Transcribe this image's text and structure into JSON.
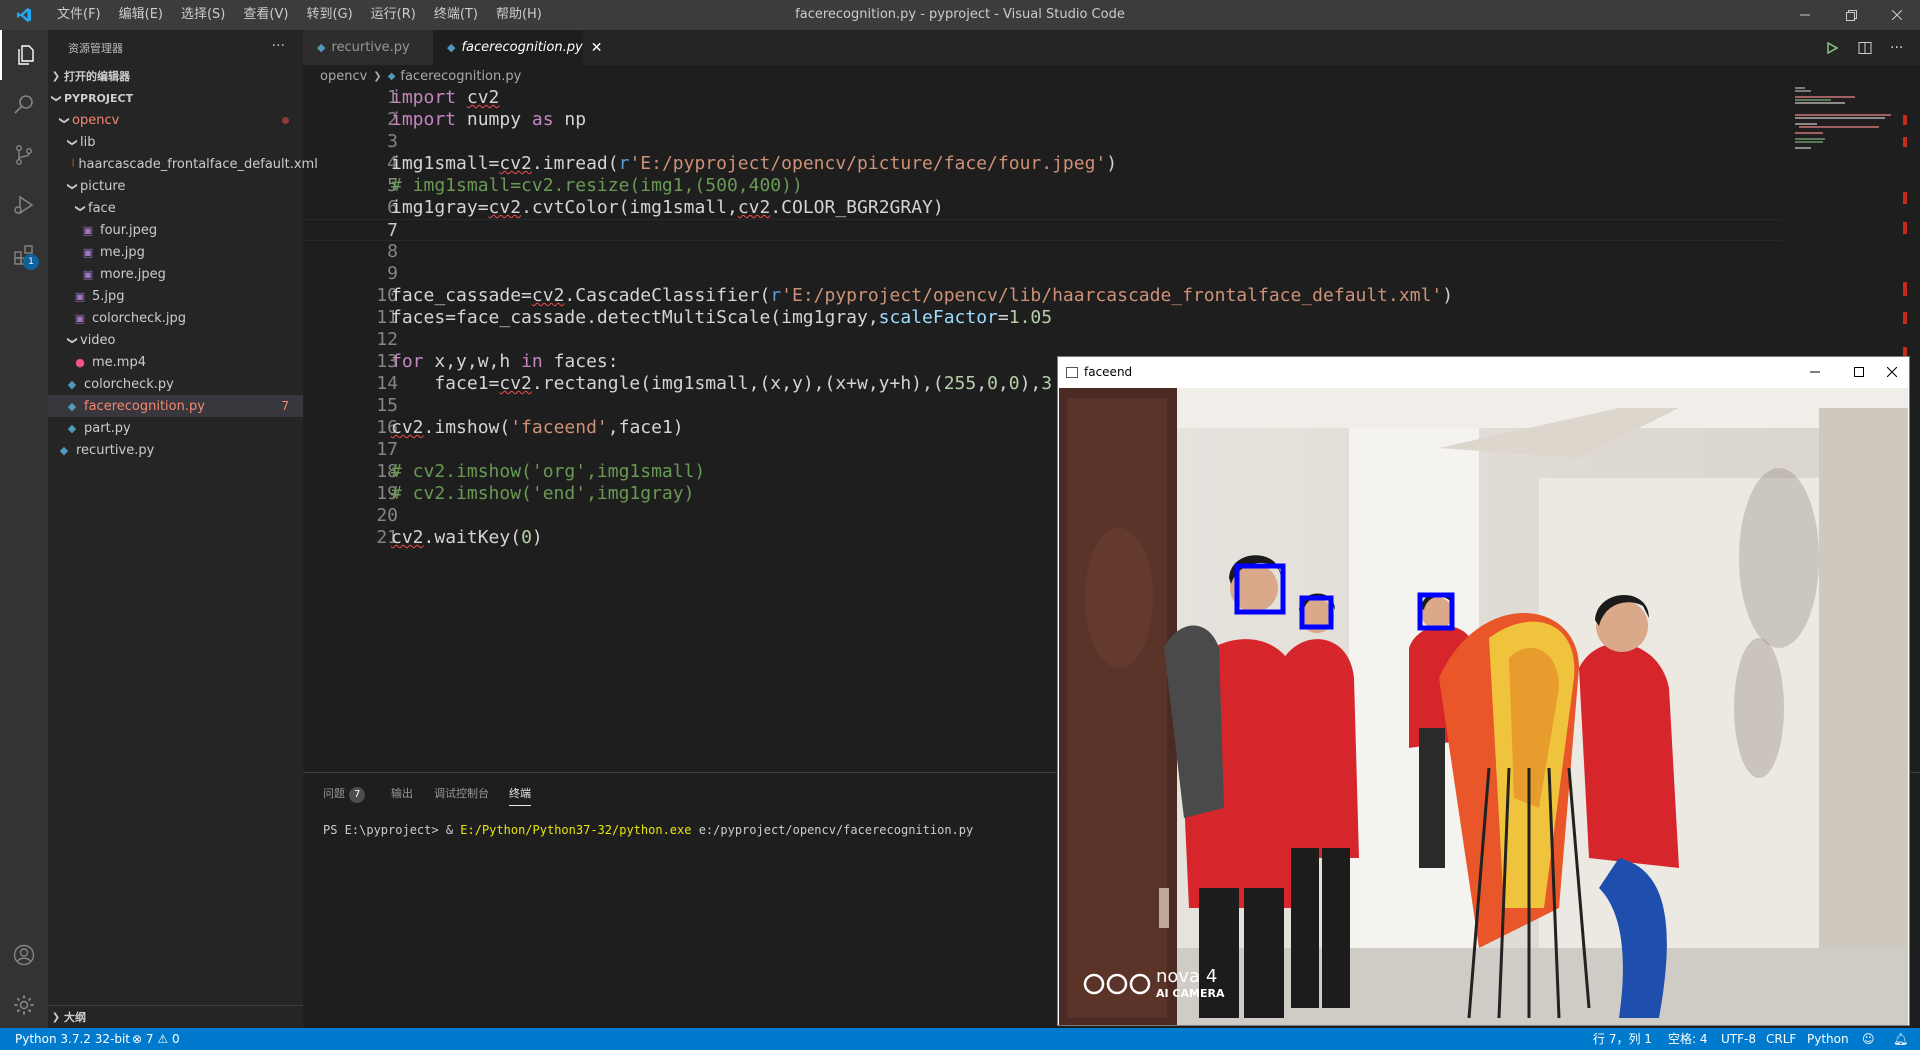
{
  "titlebar": {
    "menus": [
      "文件(F)",
      "编辑(E)",
      "选择(S)",
      "查看(V)",
      "转到(G)",
      "运行(R)",
      "终端(T)",
      "帮助(H)"
    ],
    "title": "facerecognition.py - pyproject - Visual Studio Code"
  },
  "activitybar": {
    "extensions_badge": "1"
  },
  "sidebar": {
    "title": "资源管理器",
    "more": "···",
    "open_editors": "打开的编辑器",
    "project": "PYPROJECT",
    "outline": "大纲",
    "tree": [
      {
        "label": "opencv",
        "type": "folder-open",
        "depth": 1,
        "modified_dot": true
      },
      {
        "label": "lib",
        "type": "folder-open",
        "depth": 2
      },
      {
        "label": "haarcascade_frontalface_default.xml",
        "type": "xml",
        "depth": 3
      },
      {
        "label": "picture",
        "type": "folder-open",
        "depth": 2
      },
      {
        "label": "face",
        "type": "folder-open",
        "depth": 3
      },
      {
        "label": "four.jpeg",
        "type": "image",
        "depth": 4
      },
      {
        "label": "me.jpg",
        "type": "image",
        "depth": 4
      },
      {
        "label": "more.jpeg",
        "type": "image",
        "depth": 4
      },
      {
        "label": "5.jpg",
        "type": "image",
        "depth": 3
      },
      {
        "label": "colorcheck.jpg",
        "type": "image",
        "depth": 3
      },
      {
        "label": "video",
        "type": "folder-open",
        "depth": 2
      },
      {
        "label": "me.mp4",
        "type": "video",
        "depth": 3
      },
      {
        "label": "colorcheck.py",
        "type": "python",
        "depth": 2
      },
      {
        "label": "facerecognition.py",
        "type": "python",
        "depth": 2,
        "selected": true,
        "problems": "7"
      },
      {
        "label": "part.py",
        "type": "python",
        "depth": 2
      },
      {
        "label": "recurtive.py",
        "type": "python",
        "depth": 1
      }
    ]
  },
  "tabs": [
    {
      "label": "recurtive.py",
      "active": false
    },
    {
      "label": "facerecognition.py",
      "active": true
    }
  ],
  "breadcrumb": {
    "folder": "opencv",
    "file": "facerecognition.py"
  },
  "code_lines": [
    "import cv2",
    "import numpy as np",
    "",
    "img1small=cv2.imread(r'E:/pyproject/opencv/picture/face/four.jpeg')",
    "# img1small=cv2.resize(img1,(500,400))",
    "img1gray=cv2.cvtColor(img1small,cv2.COLOR_BGR2GRAY)",
    "",
    "",
    "",
    "face_cassade=cv2.CascadeClassifier(r'E:/pyproject/opencv/lib/haarcascade_frontalface_default.xml')",
    "faces=face_cassade.detectMultiScale(img1gray,scaleFactor=1.05",
    "",
    "for x,y,w,h in faces:",
    "    face1=cv2.rectangle(img1small,(x,y),(x+w,y+h),(255,0,0),3",
    "",
    "cv2.imshow('faceend',face1)",
    "",
    "# cv2.imshow('org',img1small)",
    "# cv2.imshow('end',img1gray)",
    "",
    "cv2.waitKey(0)"
  ],
  "panel": {
    "tabs": [
      "问题",
      "输出",
      "调试控制台",
      "终端"
    ],
    "problems_count": "7",
    "terminal": {
      "prompt": "PS E:\\pyproject> & ",
      "exe": "E:/Python/Python37-32/python.exe",
      "arg": " e:/pyproject/opencv/facerecognition.py"
    }
  },
  "statusbar": {
    "interpreter": "Python 3.7.2 32-bit",
    "errors": "7",
    "warnings": "0",
    "position": "行 7，列 1",
    "spaces": "空格: 4",
    "encoding": "UTF-8",
    "eol": "CRLF",
    "language": "Python"
  },
  "faceend_window": {
    "title": "faceend",
    "watermark_brand": "nova 4",
    "watermark_sub": "AI CAMERA"
  },
  "colors": {
    "accent": "#007acc",
    "detection_box": "#0000ff",
    "vest_red": "#d6262b"
  }
}
